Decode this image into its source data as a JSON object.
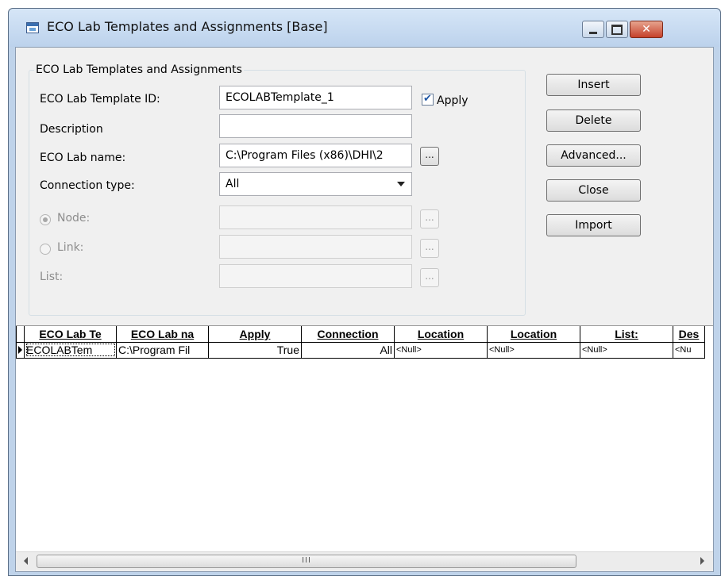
{
  "window": {
    "title": "ECO Lab Templates and Assignments [Base]",
    "min_label": "",
    "max_label": "",
    "close_label": "✕"
  },
  "group": {
    "legend": "ECO Lab Templates and Assignments",
    "template_id_label": "ECO Lab Template ID:",
    "template_id_value": "ECOLABTemplate_1",
    "apply_label": "Apply",
    "apply_checked": true,
    "description_label": "Description",
    "description_value": "",
    "ecolab_name_label": "ECO Lab name:",
    "ecolab_name_value": "C:\\Program Files (x86)\\DHI\\2",
    "connection_type_label": "Connection type:",
    "connection_type_value": "All",
    "node_label": "Node:",
    "node_selected": true,
    "link_label": "Link:",
    "list_label": "List:",
    "ellipsis": "..."
  },
  "buttons": {
    "insert": "Insert",
    "delete": "Delete",
    "advanced": "Advanced...",
    "close": "Close",
    "import": "Import"
  },
  "grid": {
    "columns": [
      "ECO Lab Te",
      "ECO Lab na",
      "Apply",
      "Connection",
      "Location",
      "Location",
      "List:",
      "Des"
    ],
    "rows": [
      [
        "ECOLABTem",
        "C:\\Program Fil",
        "True",
        "All",
        "<Null>",
        "<Null>",
        "<Null>",
        "<Nu"
      ]
    ]
  },
  "scrollbar": {
    "thumb_grip": "III"
  },
  "colors": {
    "window_frame": "#bfd3ea",
    "close_button": "#c5412a",
    "client_bg": "#f0f0f0",
    "checkbox_mark": "#1e56a5"
  }
}
